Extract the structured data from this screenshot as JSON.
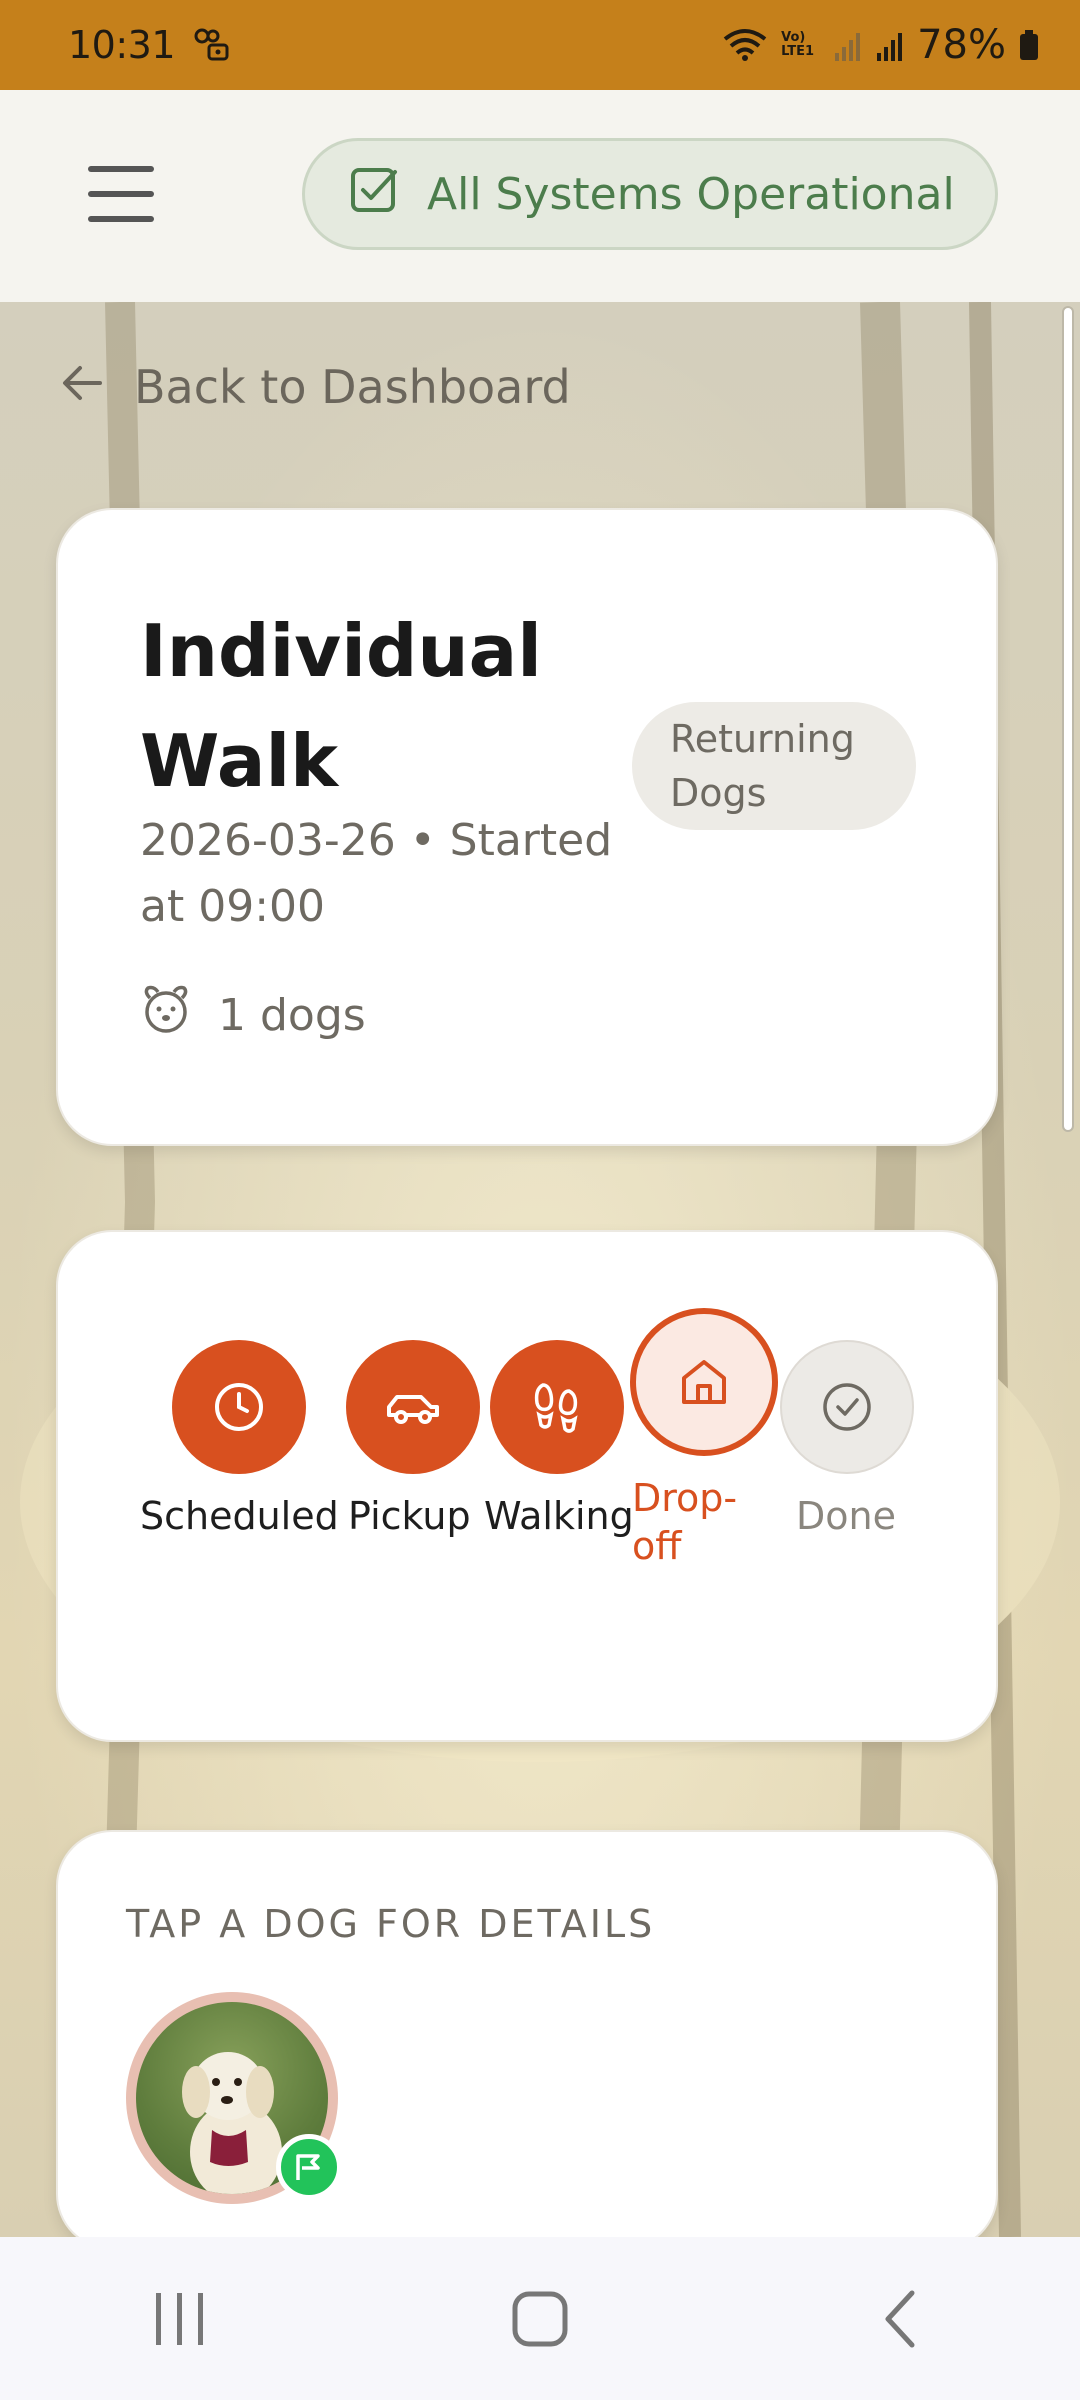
{
  "status_bar": {
    "time": "10:31",
    "network_label": "Vo) LTE1",
    "battery": "78%"
  },
  "header": {
    "system_status": "All Systems Operational"
  },
  "navigation": {
    "back_label": "Back to Dashboard"
  },
  "walk": {
    "title": "Individual Walk",
    "status": "Returning Dogs",
    "date_line": "2026-03-26 • Started at 09:00",
    "dog_count": "1 dogs"
  },
  "progress": {
    "steps": [
      {
        "label": "Scheduled",
        "state": "done",
        "icon": "clock-icon"
      },
      {
        "label": "Pickup",
        "state": "done",
        "icon": "car-icon"
      },
      {
        "label": "Walking",
        "state": "done",
        "icon": "footprints-icon"
      },
      {
        "label": "Drop-off",
        "state": "active",
        "icon": "home-icon"
      },
      {
        "label": "Done",
        "state": "pending",
        "icon": "check-circle-icon"
      }
    ]
  },
  "dogs_section": {
    "label": "TAP A DOG FOR DETAILS"
  },
  "colors": {
    "status_bar": "#c5801b",
    "accent": "#d8501f",
    "success": "#4c7d4c"
  }
}
